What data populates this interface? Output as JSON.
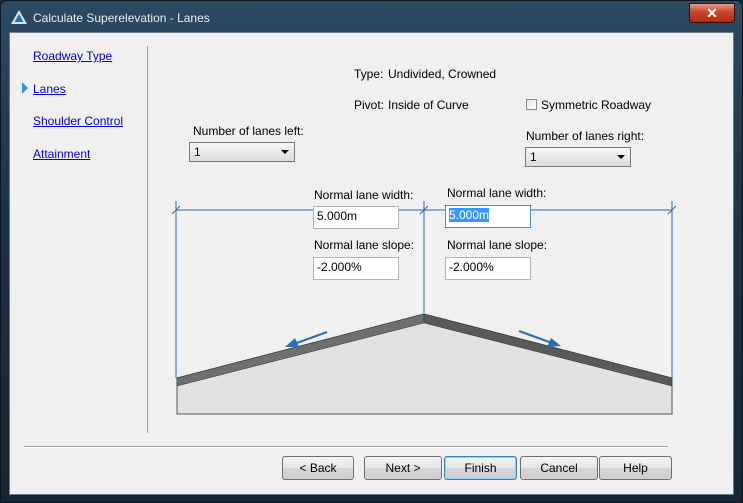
{
  "window": {
    "title": "Calculate Superelevation - Lanes"
  },
  "nav": {
    "items": [
      "Roadway Type",
      "Lanes",
      "Shoulder Control",
      "Attainment"
    ]
  },
  "info": {
    "type_label": "Type:",
    "type_value": "Undivided, Crowned",
    "pivot_label": "Pivot:",
    "pivot_value": "Inside of Curve"
  },
  "symmetric_roadway": {
    "label": "Symmetric Roadway",
    "checked": false
  },
  "lanes_left": {
    "label": "Number of lanes left:",
    "value": "1"
  },
  "lanes_right": {
    "label": "Number of lanes right:",
    "value": "1"
  },
  "left_lane": {
    "width_label": "Normal lane width:",
    "width_value": "5.000m",
    "slope_label": "Normal lane slope:",
    "slope_value": "-2.000%"
  },
  "right_lane": {
    "width_label": "Normal lane width:",
    "width_value": "5.000m",
    "slope_label": "Normal lane slope:",
    "slope_value": "-2.000%"
  },
  "buttons": {
    "back": "< Back",
    "next": "Next >",
    "finish": "Finish",
    "cancel": "Cancel",
    "help": "Help"
  },
  "colors": {
    "link": "#0000e0",
    "dimension_line": "#2f6db3",
    "close_button": "#c7452d"
  }
}
